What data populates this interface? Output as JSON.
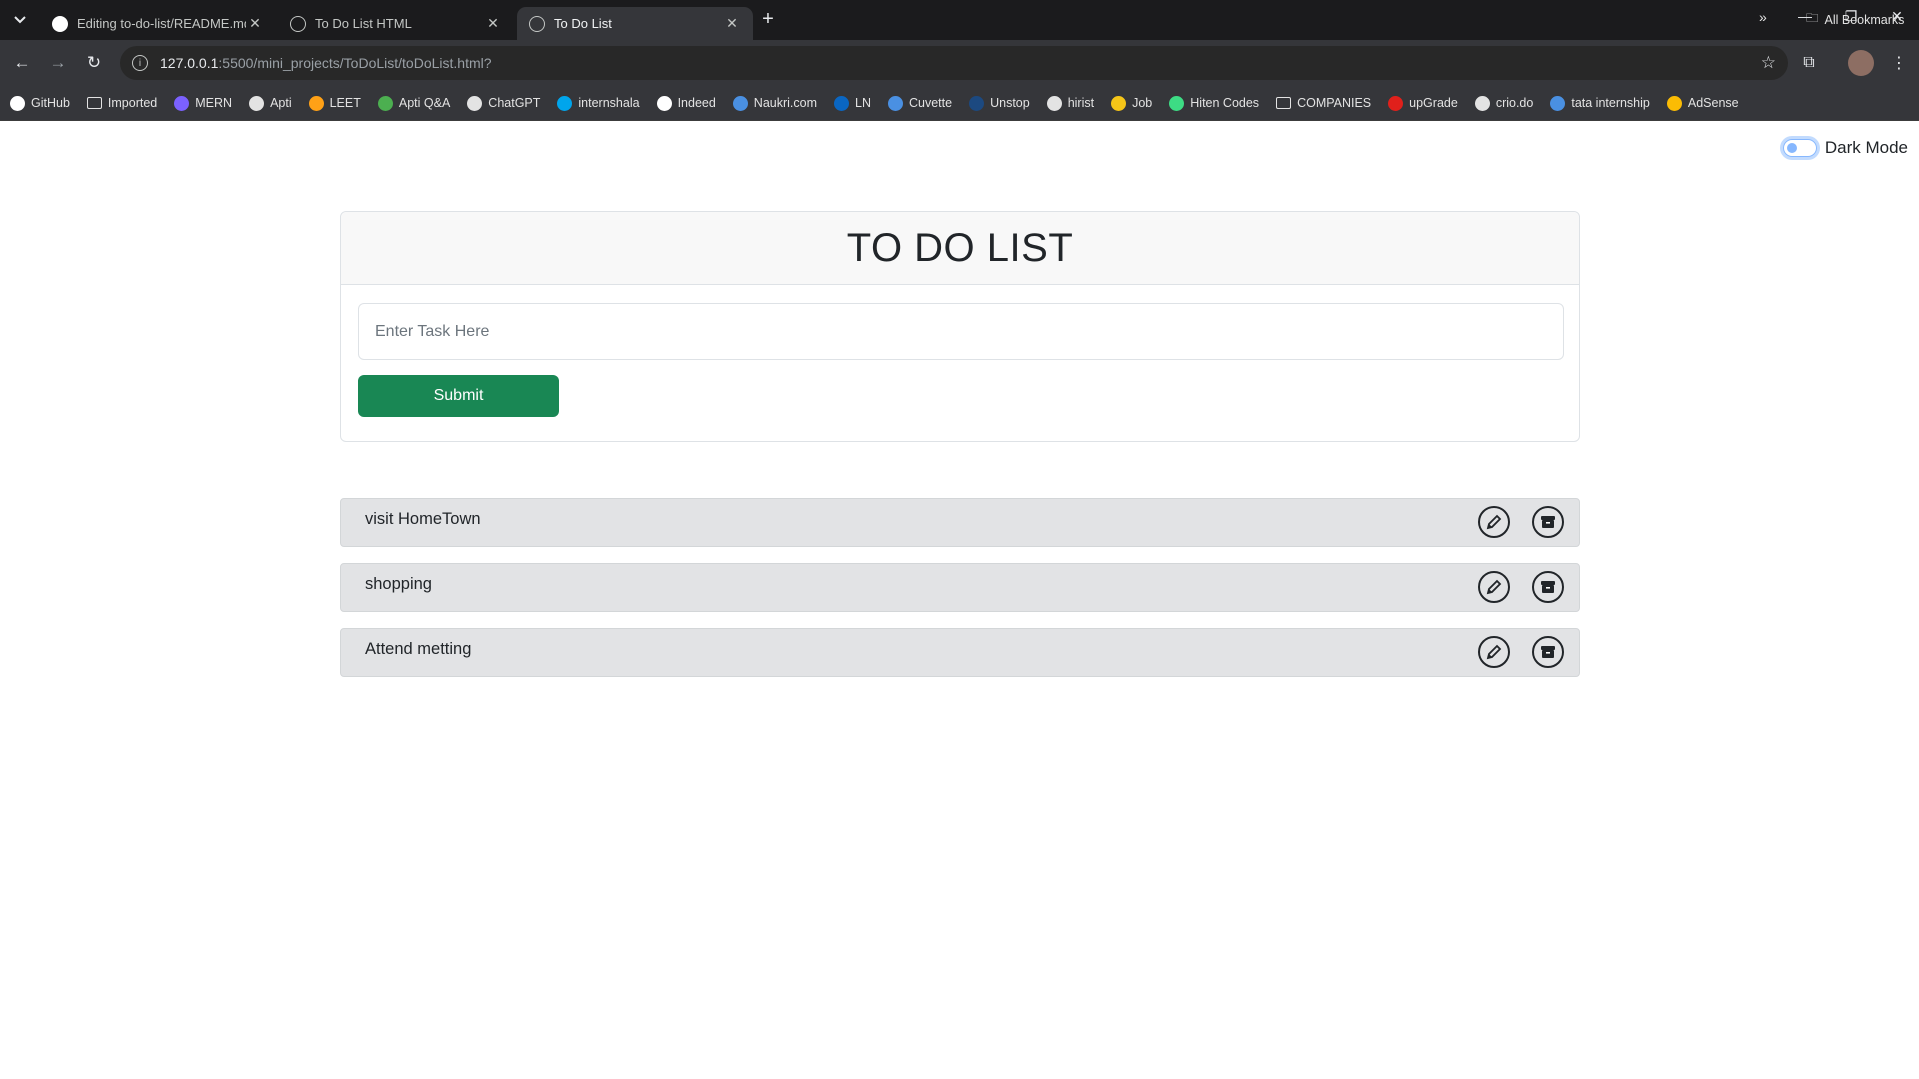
{
  "browser": {
    "tabs": [
      {
        "title": "Editing to-do-list/README.md",
        "active": false
      },
      {
        "title": "To Do List HTML",
        "active": false
      },
      {
        "title": "To Do List",
        "active": true
      }
    ],
    "url_host": "127.0.0.1",
    "url_path": ":5500/mini_projects/ToDoList/toDoList.html?",
    "bookmarks": [
      {
        "label": "GitHub",
        "icon": "github-icon",
        "color": "#ffffff"
      },
      {
        "label": "Imported",
        "icon": "folder-icon",
        "color": "#e3e3e3"
      },
      {
        "label": "MERN",
        "icon": "code-icon",
        "color": "#7b61ff"
      },
      {
        "label": "Apti",
        "icon": "globe-icon",
        "color": "#e3e3e3"
      },
      {
        "label": "LEET",
        "icon": "leetcode-icon",
        "color": "#ffa116"
      },
      {
        "label": "Apti Q&A",
        "icon": "apti-icon",
        "color": "#4caf50"
      },
      {
        "label": "ChatGPT",
        "icon": "chatgpt-icon",
        "color": "#e3e3e3"
      },
      {
        "label": "internshala",
        "icon": "internshala-icon",
        "color": "#00a5ec"
      },
      {
        "label": "Indeed",
        "icon": "info-icon",
        "color": "#ffffff"
      },
      {
        "label": "Naukri.com",
        "icon": "naukri-icon",
        "color": "#4a90e2"
      },
      {
        "label": "LN",
        "icon": "linkedin-icon",
        "color": "#0a66c2"
      },
      {
        "label": "Cuvette",
        "icon": "cuvette-icon",
        "color": "#4a90e2"
      },
      {
        "label": "Unstop",
        "icon": "unstop-icon",
        "color": "#1c4980"
      },
      {
        "label": "hirist",
        "icon": "hirist-icon",
        "color": "#e3e3e3"
      },
      {
        "label": "Job",
        "icon": "job-icon",
        "color": "#f5c518"
      },
      {
        "label": "Hiten Codes",
        "icon": "hiten-icon",
        "color": "#3ddc84"
      },
      {
        "label": "COMPANIES",
        "icon": "folder-icon",
        "color": "#e3e3e3"
      },
      {
        "label": "upGrade",
        "icon": "upgrad-icon",
        "color": "#e0201b"
      },
      {
        "label": "crio.do",
        "icon": "crio-icon",
        "color": "#e3e3e3"
      },
      {
        "label": "tata internship",
        "icon": "tata-icon",
        "color": "#4a90e2"
      },
      {
        "label": "AdSense",
        "icon": "adsense-icon",
        "color": "#fbbc04"
      }
    ],
    "more_label": "»",
    "all_bookmarks": "All Bookmarks"
  },
  "page": {
    "dark_mode_label": "Dark Mode",
    "title": "TO DO LIST",
    "input_placeholder": "Enter Task Here",
    "submit_label": "Submit",
    "tasks": [
      {
        "text": "visit HomeTown"
      },
      {
        "text": "shopping"
      },
      {
        "text": "Attend metting"
      }
    ]
  },
  "colors": {
    "submit": "#198754",
    "task_bg": "#e2e3e5"
  }
}
